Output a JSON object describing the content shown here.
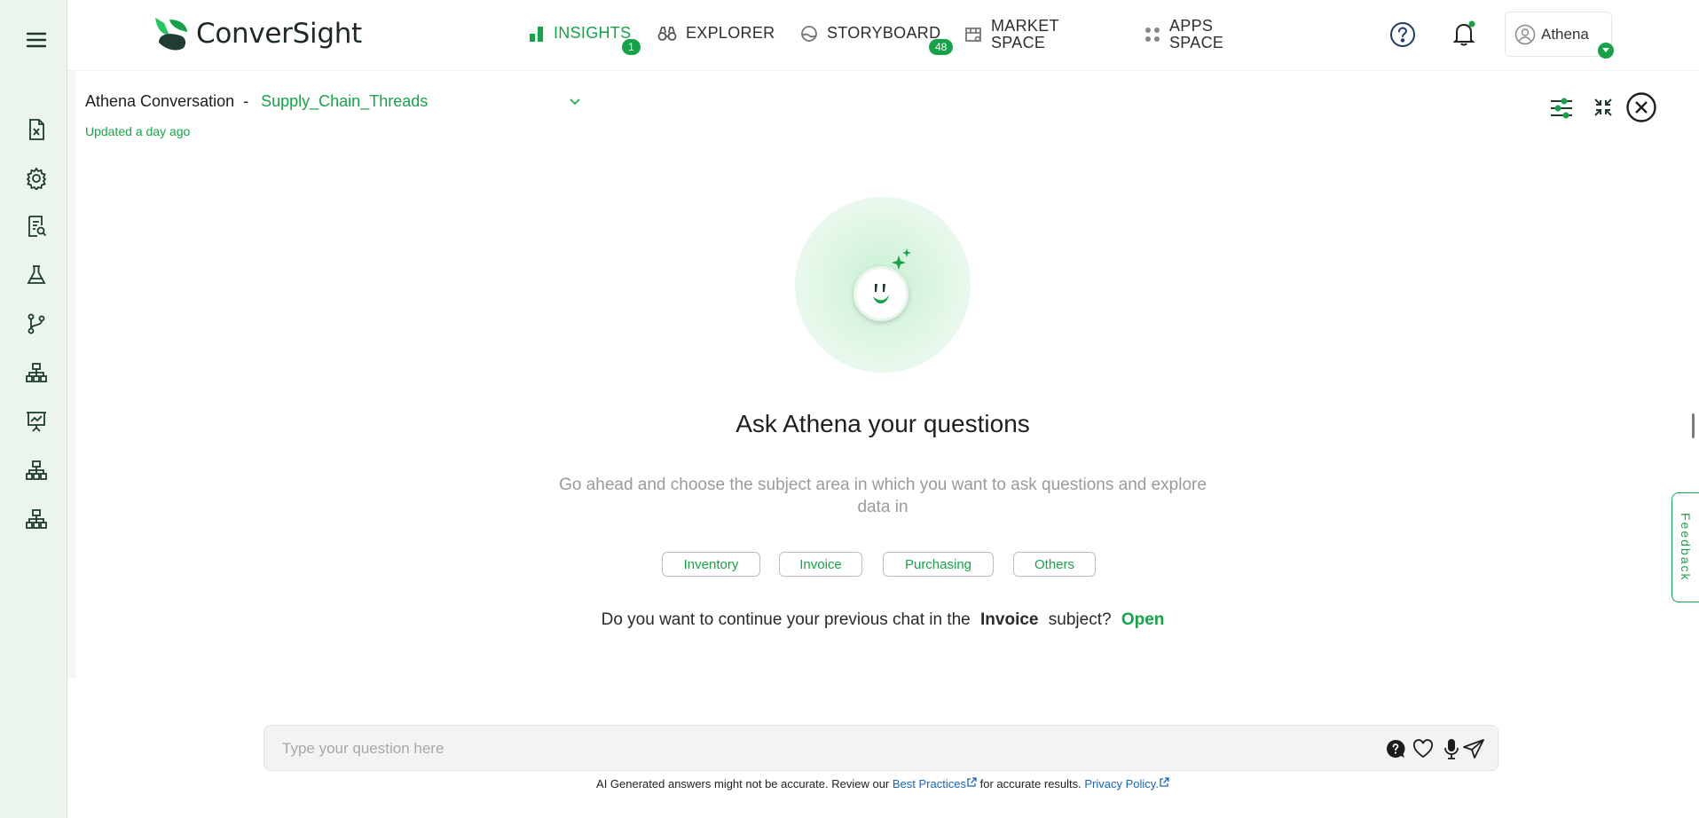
{
  "app": {
    "brand": "ConverSight"
  },
  "nav": {
    "insights": {
      "label": "INSIGHTS",
      "badge": "1"
    },
    "explorer": {
      "label": "EXPLORER"
    },
    "storyboard": {
      "label": "STORYBOARD",
      "badge": "48"
    },
    "market": {
      "line1": "MARKET",
      "line2": "SPACE"
    },
    "apps": {
      "line1": "APPS",
      "line2": "SPACE"
    }
  },
  "user": {
    "name": "Athena"
  },
  "conversation": {
    "title": "Athena Conversation",
    "separator": "-",
    "subject": "Supply_Chain_Threads",
    "updated": "Updated a day ago"
  },
  "main": {
    "heading": "Ask Athena your questions",
    "description": "Go ahead and choose the subject area in which you want to ask questions and explore data in",
    "chips": [
      "Inventory",
      "Invoice",
      "Purchasing",
      "Others"
    ],
    "continue_prefix": "Do you want to continue your previous chat in the",
    "continue_subject": "Invoice",
    "continue_suffix": "subject?",
    "continue_action": "Open"
  },
  "input": {
    "placeholder": "Type your question here"
  },
  "disclaimer": {
    "prefix": "AI Generated answers might not be accurate. Review our",
    "best_practices": "Best Practices",
    "middle": "for accurate results.",
    "privacy": "Privacy Policy."
  },
  "feedback": {
    "label": "Feedback"
  },
  "colors": {
    "accent": "#16a348",
    "rail": "#ebf5ec",
    "link": "#1565c0"
  },
  "icons": {
    "rail": [
      "menu-icon",
      "excel-file-icon",
      "settings-gear-icon",
      "report-search-icon",
      "flask-icon",
      "git-branch-icon",
      "hierarchy-icon",
      "presentation-chart-icon",
      "hierarchy-icon",
      "hierarchy-icon"
    ],
    "header": [
      "help-icon",
      "bell-icon",
      "user-icon"
    ],
    "tools": [
      "sliders-icon",
      "collapse-icon",
      "close-icon"
    ],
    "input": [
      "question-bubble-icon",
      "heart-icon",
      "microphone-icon",
      "send-icon"
    ]
  }
}
